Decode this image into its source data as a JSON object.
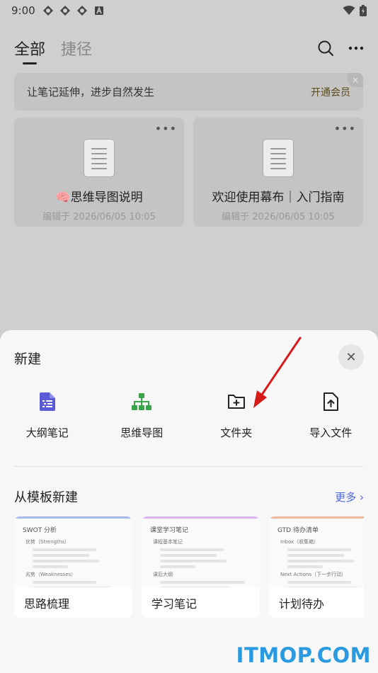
{
  "status": {
    "time": "9:00"
  },
  "header": {
    "tabs": [
      {
        "label": "全部"
      },
      {
        "label": "捷径"
      }
    ]
  },
  "promo": {
    "text": "让笔记延伸，进步自然发生",
    "cta": "开通会员"
  },
  "notes": [
    {
      "title": "🧠思维导图说明",
      "meta": "编辑于 2026/06/05 10:05"
    },
    {
      "title": "欢迎使用幕布｜入门指南",
      "meta": "编辑于 2026/06/05 10:05"
    }
  ],
  "sheet": {
    "title": "新建",
    "actions": [
      {
        "label": "大纲笔记",
        "icon": "outline-note-icon",
        "color": "#5b5bd6"
      },
      {
        "label": "思维导图",
        "icon": "mindmap-icon",
        "color": "#3aa44a"
      },
      {
        "label": "文件夹",
        "icon": "folder-add-icon",
        "color": "#222222"
      },
      {
        "label": "导入文件",
        "icon": "import-file-icon",
        "color": "#222222"
      }
    ],
    "templates_title": "从模板新建",
    "more_label": "更多 ›",
    "accent": "#4a66d8",
    "templates": [
      {
        "name": "思路梳理",
        "preview_title": "SWOT 分析",
        "row1": "优势（Strengths）",
        "row2": "劣势（Weaknesses）",
        "bar": "#a8b8f0"
      },
      {
        "name": "学习笔记",
        "preview_title": "课堂学习笔记",
        "row1": "课程基本笔记",
        "row2": "课后大纲",
        "bar": "#d8b4f0"
      },
      {
        "name": "计划待办",
        "preview_title": "GTD 待办清单",
        "row1": "Inbox（收集箱）",
        "row2": "Next Actions（下一步行动）",
        "bar": "#f4b89a"
      }
    ]
  },
  "watermark": "ITMOP.COM"
}
